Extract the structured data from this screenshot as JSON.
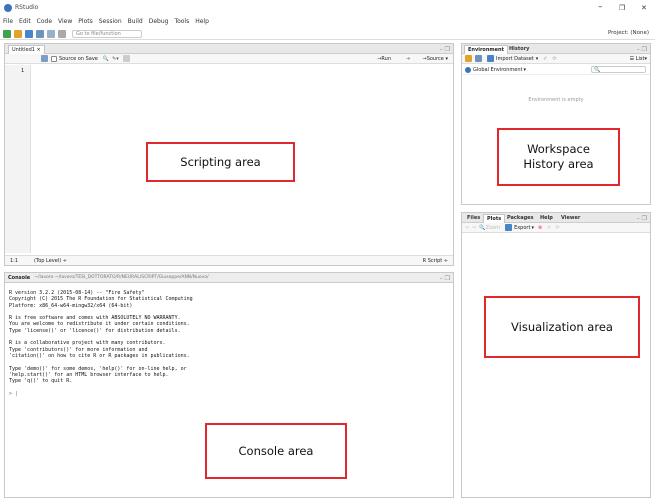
{
  "window": {
    "title": "RStudio",
    "controls": [
      "–",
      "❐",
      "✕"
    ]
  },
  "menu": [
    "File",
    "Edit",
    "Code",
    "View",
    "Plots",
    "Session",
    "Build",
    "Debug",
    "Tools",
    "Help"
  ],
  "toolbar": {
    "goto_placeholder": "Go to file/function",
    "project_label": "Project: (None)"
  },
  "editor": {
    "tab_label": "Untitled1 ×",
    "source_on_save": "Source on Save",
    "run_label": "Run",
    "source_label": "Source",
    "line_number": "1",
    "status_position": "1:1",
    "status_scope": "(Top Level) ÷",
    "status_type": "R Script ÷"
  },
  "console": {
    "header_label": "Console",
    "header_path": "~/lavoro ~/lavoro/TESI_DOTTORATO/R/NEURAL/SCRIPT/Giuseppe/ANN/Nuovo/",
    "lines": [
      "R version 3.2.2 (2015-08-14) -- \"Fire Safety\"",
      "Copyright (C) 2015 The R Foundation for Statistical Computing",
      "Platform: x86_64-w64-mingw32/x64 (64-bit)",
      "",
      "R is free software and comes with ABSOLUTELY NO WARRANTY.",
      "You are welcome to redistribute it under certain conditions.",
      "Type 'license()' or 'licence()' for distribution details.",
      "",
      "R is a collaborative project with many contributors.",
      "Type 'contributors()' for more information and",
      "'citation()' on how to cite R or R packages in publications.",
      "",
      "Type 'demo()' for some demos, 'help()' for on-line help, or",
      "'help.start()' for an HTML browser interface to help.",
      "Type 'q()' to quit R.",
      "",
      "> |"
    ]
  },
  "environment": {
    "tabs": [
      "Environment",
      "History"
    ],
    "import_label": "Import Dataset",
    "list_label": "List",
    "scope_label": "Global Environment",
    "empty_message": "Environment is empty"
  },
  "files": {
    "tabs": [
      "Files",
      "Plots",
      "Packages",
      "Help",
      "Viewer"
    ],
    "zoom_label": "Zoom",
    "export_label": "Export"
  },
  "annotations": {
    "scripting": "Scripting area",
    "workspace": "Workspace\nHistory area",
    "visualization": "Visualization area",
    "console": "Console area"
  },
  "colors": {
    "annotation_border": "#e0282d",
    "rstudio_blue": "#3b73b9",
    "tab_bg": "#e8e8e8"
  }
}
